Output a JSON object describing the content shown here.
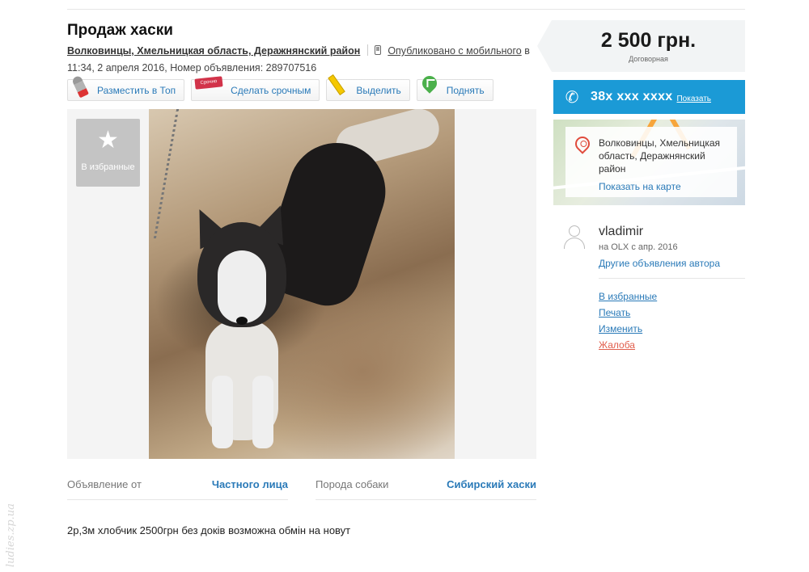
{
  "listing": {
    "title": "Продаж хаски",
    "location": "Волковинцы, Хмельницкая область, Деражнянский район",
    "published_mobile": "Опубликовано с мобильного",
    "published_tail": "в",
    "published_time": "11:34, 2 апреля 2016, Номер объявления: 289707516",
    "description": "2р,3м хлобчик 2500грн без доків возможна обмін на новут"
  },
  "promo": {
    "top": "Разместить в Топ",
    "urgent": "Сделать срочным",
    "urgent_tag": "Срочно",
    "highlight": "Выделить",
    "raise": "Поднять"
  },
  "gallery": {
    "favorite_label": "В избранные",
    "favorite_icon": "star-icon"
  },
  "params": [
    {
      "key": "Объявление от",
      "value": "Частного лица"
    },
    {
      "key": "Порода собаки",
      "value": "Сибирский хаски"
    }
  ],
  "price": {
    "amount": "2 500 грн.",
    "note": "Договорная"
  },
  "contact": {
    "phone": "38x xxx xxxx",
    "show": "Показать"
  },
  "map": {
    "address": "Волковинцы, Хмельницкая область, Деражнянский район",
    "show_on_map": "Показать на карте"
  },
  "user": {
    "name": "vladimir",
    "since": "на OLX с апр. 2016",
    "other_ads": "Другие объявления автора"
  },
  "actions": {
    "favorite": "В избранные",
    "print": "Печать",
    "edit": "Изменить",
    "report": "Жалоба"
  },
  "watermark": "ludies.zp.ua",
  "colors": {
    "link": "#2a7ab8",
    "phone_button": "#1b9ad6",
    "report": "#e15e4c"
  }
}
